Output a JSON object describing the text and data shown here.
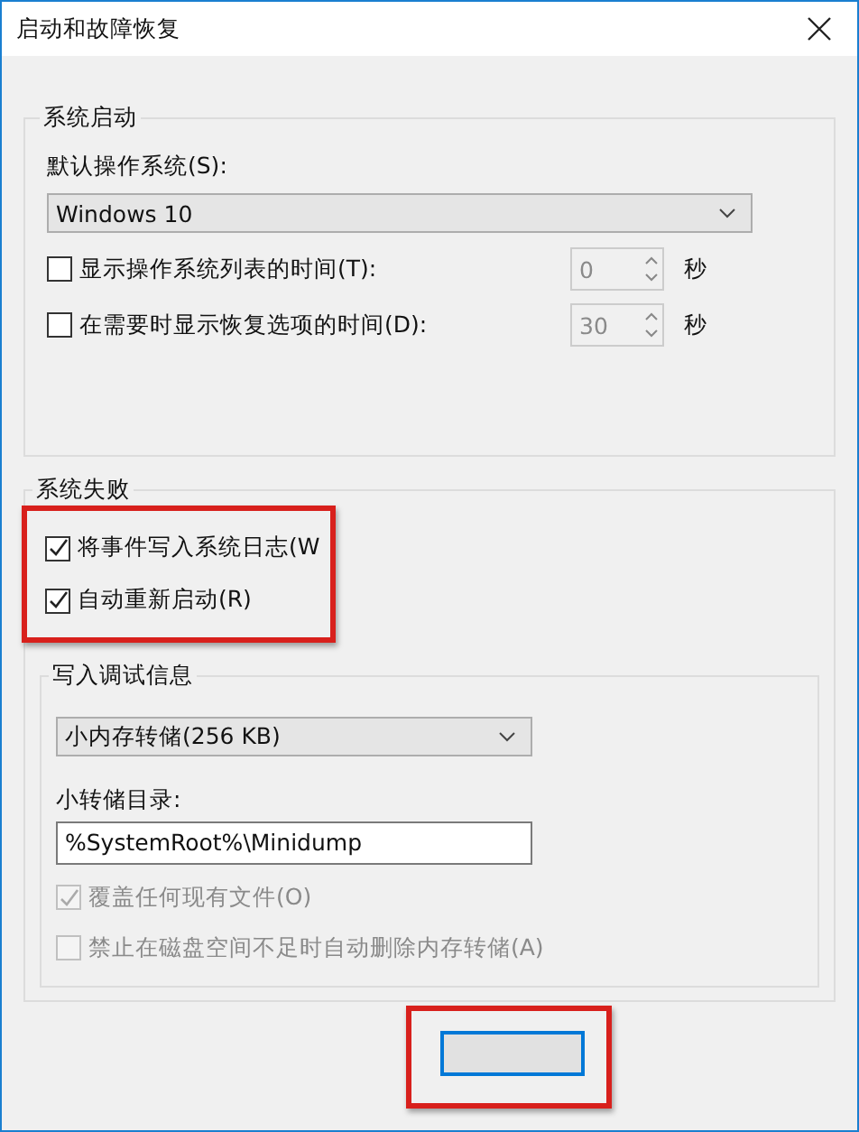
{
  "window": {
    "title": "启动和故障恢复"
  },
  "system_startup": {
    "title": "系统启动",
    "default_os_label": "默认操作系统(S):",
    "default_os": "Windows 10",
    "options": [
      {
        "label": "显示操作系统列表的时间(T):",
        "checked": false,
        "value": "0",
        "unit": "秒"
      },
      {
        "label": "在需要时显示恢复选项的时间(D):",
        "checked": false,
        "value": "30",
        "unit": "秒"
      }
    ]
  },
  "system_failure": {
    "title": "系统失败",
    "highlighted": true,
    "options": [
      {
        "label": "将事件写入系统日志(W",
        "checked": true
      },
      {
        "label": "自动重新启动(R)",
        "checked": true
      }
    ],
    "debug": {
      "title": "写入调试信息",
      "dump_type": "小内存转储(256 KB)",
      "dir_label": "小转储目录:",
      "dir_value": "%SystemRoot%\\Minidump",
      "options": [
        {
          "label": "覆盖任何现有文件(O)",
          "checked": true,
          "disabled": true
        },
        {
          "label": "禁止在磁盘空间不足时自动删除内存转储(A)",
          "checked": false,
          "disabled": true
        }
      ]
    }
  },
  "buttons": [
    {
      "kind": "default",
      "highlighted": true
    }
  ]
}
